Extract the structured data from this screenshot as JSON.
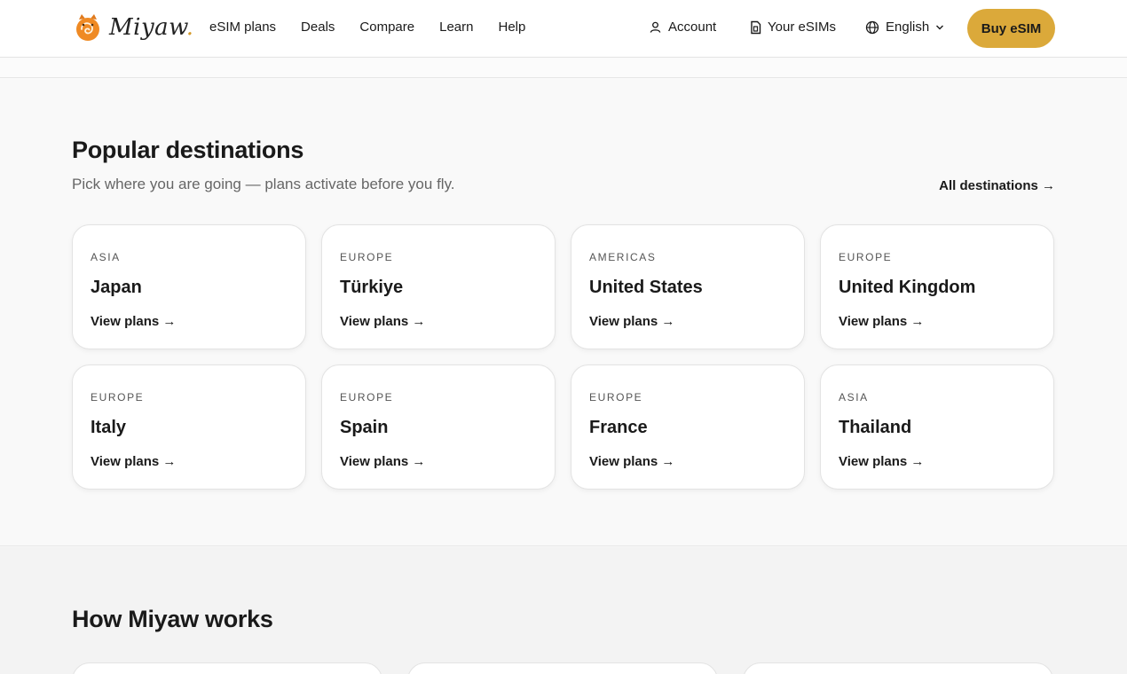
{
  "brand": {
    "name": "Miyaw",
    "dot": ".",
    "accent": "#dba93a"
  },
  "nav": [
    "eSIM plans",
    "Deals",
    "Compare",
    "Learn",
    "Help"
  ],
  "utility": {
    "account": "Account",
    "esims": "Your eSIMs",
    "language": "English",
    "buy": "Buy eSIM"
  },
  "icons": {
    "account": "user-icon",
    "esims": "sim-card-icon",
    "language": "globe-icon",
    "chevron": "chevron-down-icon"
  },
  "destinations": {
    "title": "Popular destinations",
    "subtitle": "Pick where you are going — plans activate before you fly.",
    "all_link": "All destinations →",
    "cards": [
      {
        "region": "ASIA",
        "country": "Japan",
        "link": "View plans →"
      },
      {
        "region": "EUROPE",
        "country": "Türkiye",
        "link": "View plans →"
      },
      {
        "region": "AMERICAS",
        "country": "United States",
        "link": "View plans →"
      },
      {
        "region": "EUROPE",
        "country": "United Kingdom",
        "link": "View plans →"
      },
      {
        "region": "EUROPE",
        "country": "Italy",
        "link": "View plans →"
      },
      {
        "region": "EUROPE",
        "country": "Spain",
        "link": "View plans →"
      },
      {
        "region": "EUROPE",
        "country": "France",
        "link": "View plans →"
      },
      {
        "region": "ASIA",
        "country": "Thailand",
        "link": "View plans →"
      }
    ]
  },
  "how": {
    "title": "How Miyaw works"
  }
}
